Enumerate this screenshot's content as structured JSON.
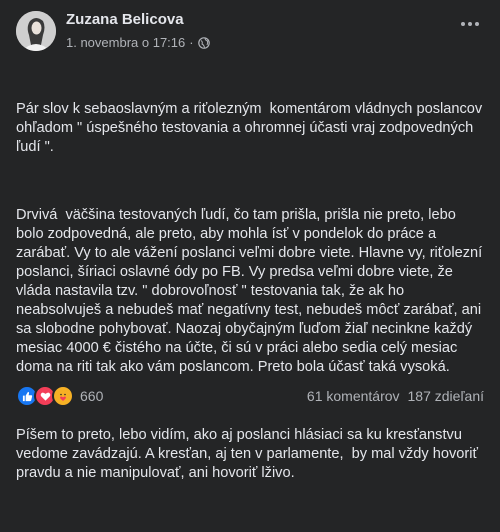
{
  "post": {
    "author": "Zuzana Belicova",
    "date": "1. novembra o 17:16",
    "separator": "·",
    "paragraphs": [
      "Pár slov k sebaoslavným a riťolezným  komentárom vládnych poslancov ohľadom \" úspešného testovania a ohromnej účasti vraj zodpovedných ľudí \".",
      "Drvivá  väčšina testovaných ľudí, čo tam prišla, prišla nie preto, lebo bolo zodpovedná, ale preto, aby mohla ísť v pondelok do práce a zarábať. Vy to ale vážení poslanci veľmi dobre viete. Hlavne vy, riťolezní poslanci, šíriaci oslavné ódy po FB. Vy predsa veľmi dobre viete, že vláda nastavila tzv. \" dobrovoľnosť \" testovania tak, že ak ho neabsolvuješ a nebudeš mať negatívny test, nebudeš môcť zarábať, ani sa slobodne pohybovať. Naozaj obyčajným ľuďom žiaľ necinkne každý mesiac 4000 € čistého na účte, či sú v práci alebo sedia celý mesiac doma na riti tak ako vám poslancom. Preto bola účasť taká vysoká.",
      "Píšem to preto, lebo vidím, ako aj poslanci hlásiaci sa ku kresťanstvu vedome zavádzajú. A kresťan, aj ten v parlamente,  by mal vždy hovoriť pravdu a nie manipulovať, ani hovoriť lživo."
    ]
  },
  "footer": {
    "reaction_count": "660",
    "comments": "61 komentárov",
    "shares": "187 zdieľaní",
    "reaction_icons": [
      "like-icon",
      "love-icon",
      "care-icon"
    ]
  },
  "colors": {
    "background": "#242526",
    "text": "#e4e6eb",
    "secondary": "#b0b3b8",
    "like": "#1877f2",
    "love": "#f33e58",
    "care": "#f7b125"
  }
}
